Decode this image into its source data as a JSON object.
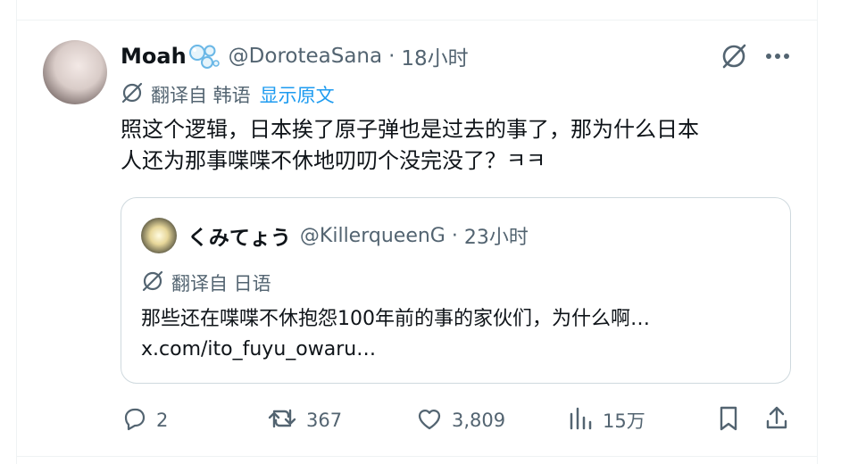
{
  "tweet": {
    "author_name": "Moah",
    "author_handle": "@DoroteaSana",
    "separator": "·",
    "time": "18小时",
    "translated_from_label": "翻译自 韩语",
    "show_original_label": "显示原文",
    "text": "照这个逻辑，日本挨了原子弹也是过去的事了，那为什么日本\n人还为那事喋喋不休地叨叨个没完没了？ㅋㅋ"
  },
  "quote": {
    "author_name": "くみてょう",
    "author_handle": "@KillerqueenG",
    "separator": "·",
    "time": "23小时",
    "translated_from_label": "翻译自 日语",
    "text_line1": "那些还在喋喋不休抱怨100年前的事的家伙们，为什么啊…",
    "text_line2": "x.com/ito_fuyu_owaru…"
  },
  "actions": {
    "replies": "2",
    "retweets": "367",
    "likes": "3,809",
    "views": "15万"
  },
  "icons": {
    "grok": "grok-icon",
    "more": "more-icon",
    "translate": "translate-icon",
    "reply": "reply-icon",
    "retweet": "retweet-icon",
    "like": "heart-icon",
    "views": "views-icon",
    "bookmark": "bookmark-icon",
    "share": "share-icon"
  },
  "colors": {
    "text": "#0f1419",
    "secondary": "#536471",
    "link": "#1d9bf0",
    "border": "#cfd9de"
  }
}
